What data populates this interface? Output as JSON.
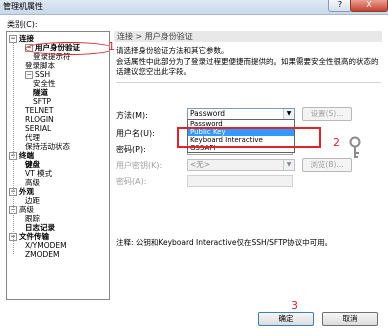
{
  "window": {
    "title": "管理机属性",
    "help": "?",
    "close": "X"
  },
  "category_label": "类别(C):",
  "tree": [
    {
      "label": "连接",
      "bold": true,
      "expander": "⊟"
    },
    {
      "label": "用户身份验证",
      "bold": true,
      "expander": "⊟"
    },
    {
      "label": "登录提示符",
      "bold": false,
      "expander": ""
    },
    {
      "label": "登录脚本",
      "bold": false,
      "expander": ""
    },
    {
      "label": "SSH",
      "bold": false,
      "expander": "⊟"
    },
    {
      "label": "安全性",
      "bold": false,
      "expander": ""
    },
    {
      "label": "隧道",
      "bold": true,
      "expander": ""
    },
    {
      "label": "SFTP",
      "bold": false,
      "expander": ""
    },
    {
      "label": "TELNET",
      "bold": false,
      "expander": ""
    },
    {
      "label": "RLOGIN",
      "bold": false,
      "expander": ""
    },
    {
      "label": "SERIAL",
      "bold": false,
      "expander": ""
    },
    {
      "label": "代理",
      "bold": false,
      "expander": ""
    },
    {
      "label": "保持活动状态",
      "bold": false,
      "expander": ""
    },
    {
      "label": "终端",
      "bold": true,
      "expander": "⊟"
    },
    {
      "label": "键盘",
      "bold": true,
      "expander": ""
    },
    {
      "label": "VT 模式",
      "bold": false,
      "expander": ""
    },
    {
      "label": "高级",
      "bold": false,
      "expander": ""
    },
    {
      "label": "外观",
      "bold": true,
      "expander": "⊟"
    },
    {
      "label": "边距",
      "bold": false,
      "expander": ""
    },
    {
      "label": "高级",
      "bold": false,
      "expander": "⊟"
    },
    {
      "label": "跟踪",
      "bold": false,
      "expander": ""
    },
    {
      "label": "日志记录",
      "bold": true,
      "expander": ""
    },
    {
      "label": "文件传输",
      "bold": true,
      "expander": "⊟"
    },
    {
      "label": "X/YMODEM",
      "bold": false,
      "expander": ""
    },
    {
      "label": "ZMODEM",
      "bold": false,
      "expander": ""
    }
  ],
  "panel": {
    "header": "连接 > 用户身份验证",
    "desc1": "请选择身份验证方法和其它参数。",
    "desc2": "会话属性中此部分为了登录过程更便捷而提供的。如果需要安全性很高的状态的话建议您空出此字段。",
    "method_label": "方法(M):",
    "method_value": "Password",
    "settings_button": "设置(S)...",
    "username_label": "用户名(U):",
    "password_label": "密码(P):",
    "userkey_label": "用户密钥(K):",
    "userkey_value": "<无>",
    "browse_button": "浏览(B)...",
    "passphrase_label": "密码(A):",
    "note": "注释: 公钥和Keyboard Interactive仅在SSH/SFTP协议中可用。"
  },
  "dropdown_options": [
    "Password",
    "Public Key",
    "Keyboard Interactive",
    "GSSAPI"
  ],
  "dropdown_selected_index": 1,
  "annotations": {
    "a1": "1",
    "a2": "2",
    "a3": "3"
  },
  "buttons": {
    "ok": "确定",
    "cancel": "取消"
  },
  "colors": {
    "annotation_red": "#e0242a",
    "selection_blue": "#3399ff"
  }
}
